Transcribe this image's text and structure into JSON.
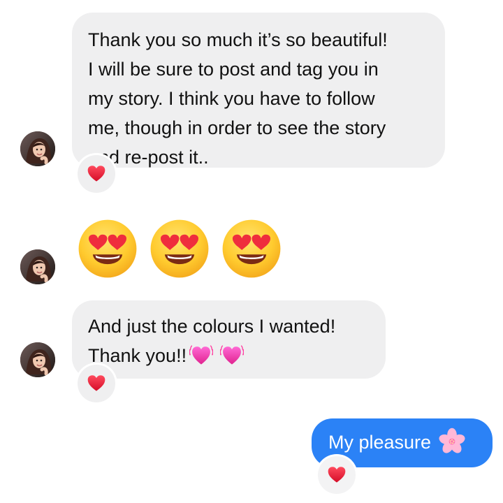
{
  "conversation": {
    "messages": [
      {
        "sender": "them",
        "lines": [
          "Thank you so much it’s so beautiful!",
          "I will be sure to post and tag you in",
          "my story. I think you have to follow",
          "me, though in order to see the story",
          "and re-post it.."
        ],
        "reaction": "red-heart"
      },
      {
        "sender": "them",
        "emoji_only": [
          "heart-eyes-emoji",
          "heart-eyes-emoji",
          "heart-eyes-emoji"
        ]
      },
      {
        "sender": "them",
        "lines": [
          "And just the colours I wanted!",
          "Thank you!!"
        ],
        "trailing_emoji": [
          "beating-heart-emoji",
          "beating-heart-emoji"
        ],
        "reaction": "red-heart"
      },
      {
        "sender": "me",
        "text": "My pleasure",
        "trailing_emoji": [
          "cherry-blossom-emoji"
        ],
        "reaction": "red-heart"
      }
    ]
  },
  "colors": {
    "incoming_bubble": "#efeff0",
    "outgoing_bubble": "#2b82f6",
    "text_dark": "#111111",
    "text_light": "#ffffff",
    "heart": "#e3122e"
  }
}
